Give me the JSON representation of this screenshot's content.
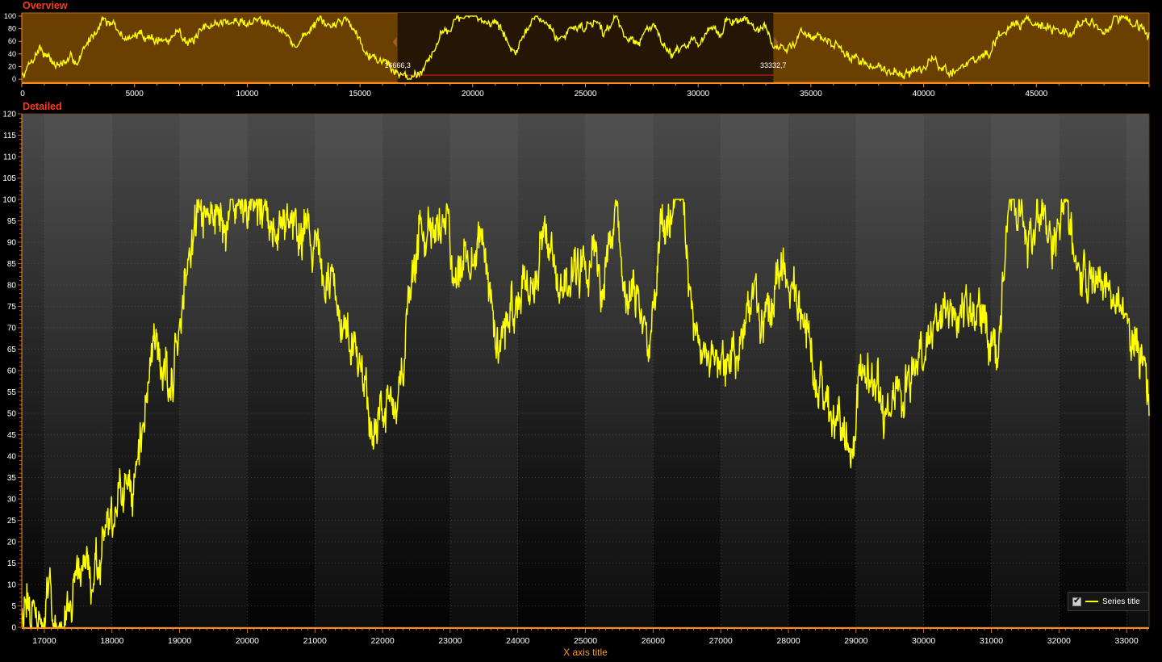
{
  "overview": {
    "title": "Overview",
    "range_start_label": "16666,3",
    "range_end_label": "33332,7",
    "range_start": 16666.3,
    "range_end": 33332.7
  },
  "detailed": {
    "title": "Detailed"
  },
  "legend": {
    "label": "Series title",
    "checked": true,
    "check_glyph": "✔"
  },
  "colors": {
    "series": "#ffff00",
    "panel_title": "#ff3a1a",
    "axis_title": "#ff9a1a",
    "overview_band": "#6a3f00",
    "overview_band_light": "#7a4800",
    "overview_selected": "#241504"
  },
  "chart_data": [
    {
      "type": "line",
      "name": "overview",
      "title": "Overview",
      "xlabel": "",
      "ylabel": "",
      "xlim": [
        0,
        50000
      ],
      "ylim": [
        -5,
        105
      ],
      "x_ticks": [
        0,
        5000,
        10000,
        15000,
        20000,
        25000,
        30000,
        35000,
        40000,
        45000
      ],
      "y_ticks": [
        0,
        20,
        40,
        60,
        80,
        100
      ],
      "grid": false,
      "anchors": [
        [
          0,
          5
        ],
        [
          800,
          52
        ],
        [
          1500,
          22
        ],
        [
          2500,
          30
        ],
        [
          3600,
          100
        ],
        [
          4500,
          65
        ],
        [
          5500,
          70
        ],
        [
          6500,
          58
        ],
        [
          7000,
          80
        ],
        [
          7500,
          55
        ],
        [
          8000,
          72
        ],
        [
          8500,
          90
        ],
        [
          10000,
          90
        ],
        [
          11000,
          98
        ],
        [
          11500,
          78
        ],
        [
          12000,
          55
        ],
        [
          12300,
          58
        ],
        [
          13000,
          90
        ],
        [
          13500,
          80
        ],
        [
          14400,
          98
        ],
        [
          15100,
          60
        ],
        [
          15500,
          40
        ],
        [
          16000,
          30
        ],
        [
          16800,
          6
        ],
        [
          17400,
          5
        ],
        [
          18000,
          30
        ],
        [
          18500,
          65
        ],
        [
          19200,
          95
        ],
        [
          20000,
          97
        ],
        [
          21000,
          93
        ],
        [
          21800,
          45
        ],
        [
          22200,
          52
        ],
        [
          22600,
          95
        ],
        [
          23200,
          93
        ],
        [
          23800,
          60
        ],
        [
          24400,
          83
        ],
        [
          25000,
          84
        ],
        [
          25500,
          100
        ],
        [
          25800,
          72
        ],
        [
          26300,
          99
        ],
        [
          26600,
          80
        ],
        [
          27200,
          55
        ],
        [
          28000,
          85
        ],
        [
          28300,
          72
        ],
        [
          28800,
          42
        ],
        [
          29300,
          55
        ],
        [
          30000,
          62
        ],
        [
          30500,
          74
        ],
        [
          31000,
          65
        ],
        [
          31200,
          98
        ],
        [
          31700,
          88
        ],
        [
          32000,
          96
        ],
        [
          32500,
          82
        ],
        [
          33000,
          75
        ],
        [
          33300,
          52
        ],
        [
          34000,
          45
        ],
        [
          34600,
          80
        ],
        [
          35500,
          60
        ],
        [
          36000,
          55
        ],
        [
          36500,
          40
        ],
        [
          37500,
          25
        ],
        [
          38500,
          15
        ],
        [
          39500,
          10
        ],
        [
          40500,
          28
        ],
        [
          41000,
          10
        ],
        [
          42000,
          25
        ],
        [
          43000,
          45
        ],
        [
          44000,
          90
        ],
        [
          44500,
          95
        ],
        [
          45000,
          92
        ],
        [
          45500,
          88
        ],
        [
          46000,
          70
        ],
        [
          46500,
          72
        ],
        [
          47000,
          90
        ],
        [
          47500,
          88
        ],
        [
          48000,
          70
        ],
        [
          48500,
          95
        ],
        [
          49500,
          85
        ],
        [
          50000,
          68
        ]
      ]
    },
    {
      "type": "line",
      "name": "detailed",
      "title": "Detailed",
      "xlabel": "X axis title",
      "ylabel": "",
      "xlim": [
        16666.3,
        33332.7
      ],
      "ylim": [
        0,
        120
      ],
      "x_ticks": [
        17000,
        18000,
        19000,
        20000,
        21000,
        22000,
        23000,
        24000,
        25000,
        26000,
        27000,
        28000,
        29000,
        30000,
        31000,
        32000,
        33000
      ],
      "y_ticks": [
        0,
        5,
        10,
        15,
        20,
        25,
        30,
        35,
        40,
        45,
        50,
        55,
        60,
        65,
        70,
        75,
        80,
        85,
        90,
        95,
        100,
        105,
        110,
        115,
        120
      ],
      "grid": true,
      "legend_position": "bottom-right",
      "series": [
        {
          "name": "Series title",
          "color": "#ffff00",
          "anchors": [
            [
              16666,
              7
            ],
            [
              16800,
              3
            ],
            [
              17000,
              1
            ],
            [
              17050,
              8
            ],
            [
              17200,
              2
            ],
            [
              17400,
              3
            ],
            [
              17500,
              12
            ],
            [
              17650,
              18
            ],
            [
              17700,
              9
            ],
            [
              17850,
              15
            ],
            [
              18000,
              22
            ],
            [
              18200,
              32
            ],
            [
              18300,
              28
            ],
            [
              18400,
              45
            ],
            [
              18500,
              52
            ],
            [
              18600,
              64
            ],
            [
              18700,
              65
            ],
            [
              18800,
              60
            ],
            [
              18900,
              60
            ],
            [
              19000,
              75
            ],
            [
              19100,
              84
            ],
            [
              19150,
              85
            ],
            [
              19250,
              97
            ],
            [
              19400,
              92
            ],
            [
              19500,
              96
            ],
            [
              19700,
              96
            ],
            [
              20000,
              98
            ],
            [
              20200,
              97
            ],
            [
              20400,
              97
            ],
            [
              20700,
              97
            ],
            [
              20900,
              95
            ],
            [
              21050,
              85
            ],
            [
              21200,
              78
            ],
            [
              21400,
              72
            ],
            [
              21600,
              65
            ],
            [
              21750,
              58
            ],
            [
              21850,
              45
            ],
            [
              22000,
              55
            ],
            [
              22150,
              50
            ],
            [
              22300,
              62
            ],
            [
              22400,
              78
            ],
            [
              22550,
              94
            ],
            [
              22650,
              90
            ],
            [
              22750,
              93
            ],
            [
              22900,
              98
            ],
            [
              23050,
              82
            ],
            [
              23300,
              92
            ],
            [
              23500,
              90
            ],
            [
              23700,
              62
            ],
            [
              23900,
              72
            ],
            [
              24100,
              80
            ],
            [
              24300,
              85
            ],
            [
              24400,
              88
            ],
            [
              24600,
              83
            ],
            [
              24800,
              82
            ],
            [
              25000,
              85
            ],
            [
              25300,
              82
            ],
            [
              25450,
              100
            ],
            [
              25600,
              80
            ],
            [
              25800,
              75
            ],
            [
              25950,
              70
            ],
            [
              26100,
              88
            ],
            [
              26300,
              99
            ],
            [
              26450,
              97
            ],
            [
              26600,
              70
            ],
            [
              26800,
              65
            ],
            [
              27000,
              60
            ],
            [
              27100,
              62
            ],
            [
              27300,
              68
            ],
            [
              27500,
              78
            ],
            [
              27700,
              72
            ],
            [
              27900,
              80
            ],
            [
              28050,
              82
            ],
            [
              28200,
              76
            ],
            [
              28300,
              65
            ],
            [
              28500,
              55
            ],
            [
              28700,
              48
            ],
            [
              28950,
              40
            ],
            [
              29050,
              60
            ],
            [
              29200,
              62
            ],
            [
              29400,
              47
            ],
            [
              29600,
              55
            ],
            [
              29900,
              60
            ],
            [
              30000,
              62
            ],
            [
              30100,
              68
            ],
            [
              30400,
              75
            ],
            [
              30700,
              70
            ],
            [
              30900,
              75
            ],
            [
              31100,
              62
            ],
            [
              31250,
              98
            ],
            [
              31400,
              96
            ],
            [
              31600,
              92
            ],
            [
              31800,
              98
            ],
            [
              31900,
              90
            ],
            [
              32100,
              95
            ],
            [
              32300,
              80
            ],
            [
              32500,
              85
            ],
            [
              32700,
              82
            ],
            [
              32900,
              72
            ],
            [
              33100,
              68
            ],
            [
              33332,
              52
            ]
          ]
        }
      ]
    }
  ]
}
